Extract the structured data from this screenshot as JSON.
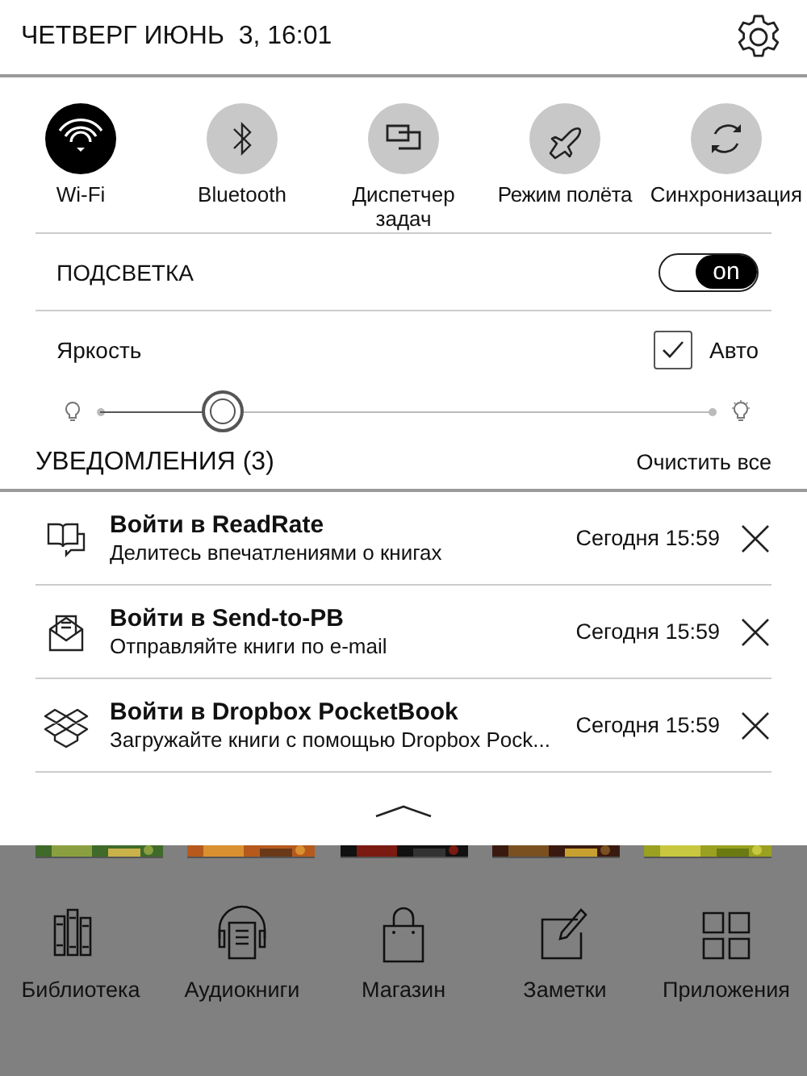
{
  "status_bar": {
    "datetime": "ЧЕТВЕРГ ИЮНЬ  3, 16:01"
  },
  "quick_toggles": [
    {
      "label": "Wi-Fi",
      "on": true
    },
    {
      "label": "Bluetooth",
      "on": false
    },
    {
      "label": "Диспетчер задач",
      "on": false
    },
    {
      "label": "Режим полёта",
      "on": false
    },
    {
      "label": "Синхронизация",
      "on": false
    }
  ],
  "backlight": {
    "label": "ПОДСВЕТКА",
    "on": true,
    "switch_text": "on"
  },
  "brightness": {
    "label": "Яркость",
    "auto_label": "Авто",
    "auto_checked": true,
    "level": 0.2
  },
  "notifications": {
    "title": "УВЕДОМЛЕНИЯ (3)",
    "clear_all": "Очистить все",
    "items": [
      {
        "title": "Войти в ReadRate",
        "text": "Делитесь впечатлениями о книгах",
        "time": "Сегодня 15:59"
      },
      {
        "title": "Войти в Send-to-PB",
        "text": "Отправляйте книги по e-mail",
        "time": "Сегодня 15:59"
      },
      {
        "title": "Войти в Dropbox PocketBook",
        "text": "Загружайте книги с помощью Dropbox Pock...",
        "time": "Сегодня 15:59"
      }
    ]
  },
  "dock": [
    {
      "label": "Библиотека"
    },
    {
      "label": "Аудиокниги"
    },
    {
      "label": "Магазин"
    },
    {
      "label": "Заметки"
    },
    {
      "label": "Приложения"
    }
  ]
}
